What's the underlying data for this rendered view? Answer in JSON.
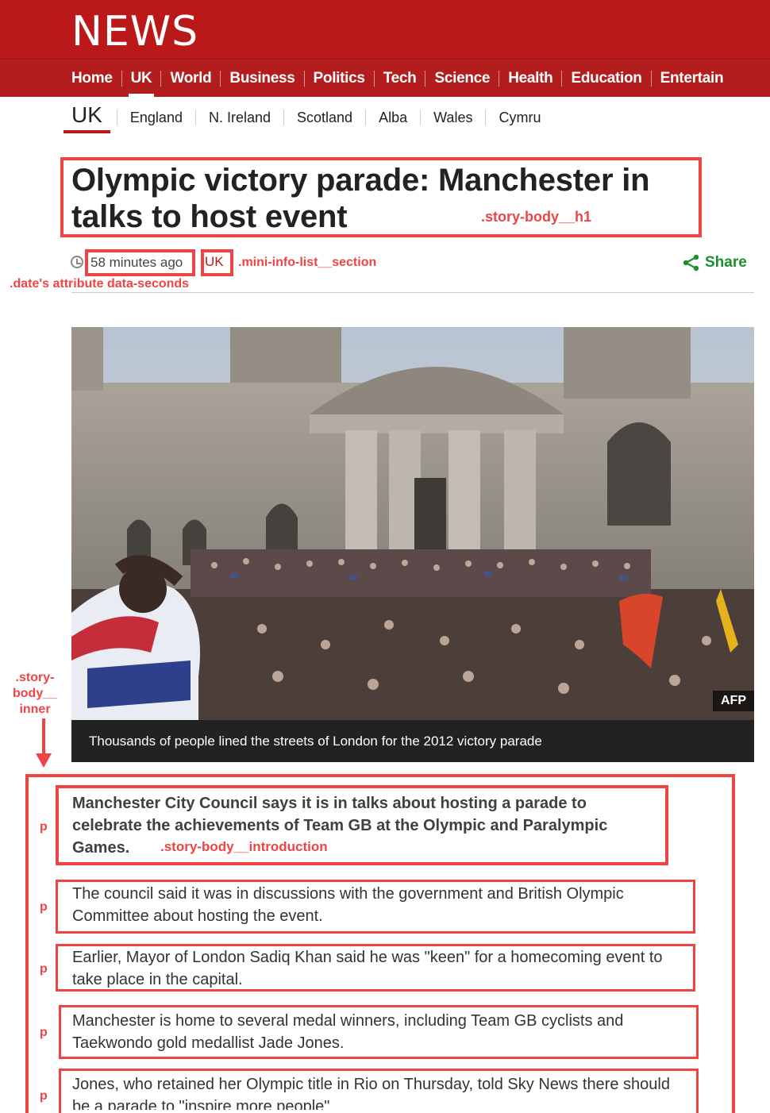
{
  "masthead": {
    "logo": "NEWS",
    "nav": [
      "Home",
      "UK",
      "World",
      "Business",
      "Politics",
      "Tech",
      "Science",
      "Health",
      "Education",
      "Entertain"
    ]
  },
  "subnav": {
    "current": "UK",
    "items": [
      "England",
      "N. Ireland",
      "Scotland",
      "Alba",
      "Wales",
      "Cymru"
    ]
  },
  "article": {
    "headline": "Olympic victory parade: Manchester in talks to host event",
    "time": "58 minutes ago",
    "section": "UK",
    "share_label": "Share",
    "image_credit": "AFP",
    "caption": "Thousands of people lined the streets of London for the 2012 victory parade",
    "introduction": "Manchester City Council says it is in talks about hosting a parade to celebrate the achievements of Team GB at the Olympic and Paralympic Games.",
    "paragraphs": [
      "The council said it was in discussions with the government and British Olympic Committee about hosting the event.",
      "Earlier, Mayor of London Sadiq Khan said he was \"keen\" for a homecoming event to take place in the capital.",
      "Manchester is home to several medal winners, including Team GB cyclists and Taekwondo gold medallist Jade Jones.",
      "Jones, who retained her Olympic title in Rio on Thursday, told Sky News there should be a parade to \"inspire more people\""
    ]
  },
  "annotations": {
    "h1": ".story-body__h1",
    "section": ".mini-info-list__section",
    "date": ".date's attribute data-seconds",
    "inner": ".story-\nbody__\ninner",
    "intro": ".story-body__introduction",
    "p": "p"
  },
  "colors": {
    "brand": "#bb1919",
    "annotation": "#ef4444",
    "share": "#1d8e2f"
  }
}
